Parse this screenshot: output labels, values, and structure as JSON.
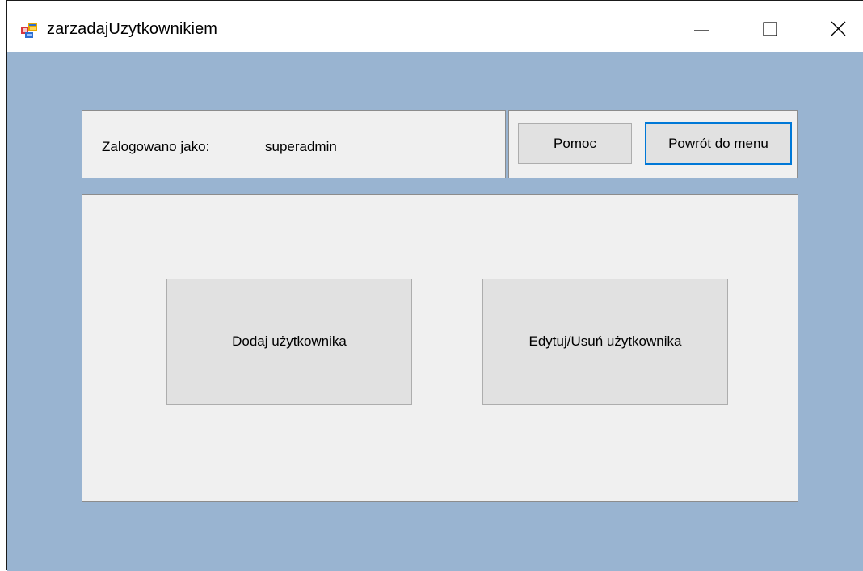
{
  "window": {
    "title": "zarzadajUzytkownikiem",
    "icon": "winforms-app-icon",
    "controls": {
      "minimize_icon": "minimize-icon",
      "maximize_icon": "maximize-icon",
      "close_icon": "close-icon"
    }
  },
  "login_panel": {
    "label": "Zalogowano jako:",
    "username": "superadmin"
  },
  "top_buttons": {
    "help_label": "Pomoc",
    "back_label": "Powrót do menu"
  },
  "main_panel": {
    "add_user_label": "Dodaj użytkownika",
    "edit_delete_user_label": "Edytuj/Usuń użytkownika"
  },
  "colors": {
    "client_background": "#99b4d1",
    "panel_background": "#f0f0f0",
    "button_face": "#e1e1e1",
    "focus_border": "#0078d7"
  }
}
